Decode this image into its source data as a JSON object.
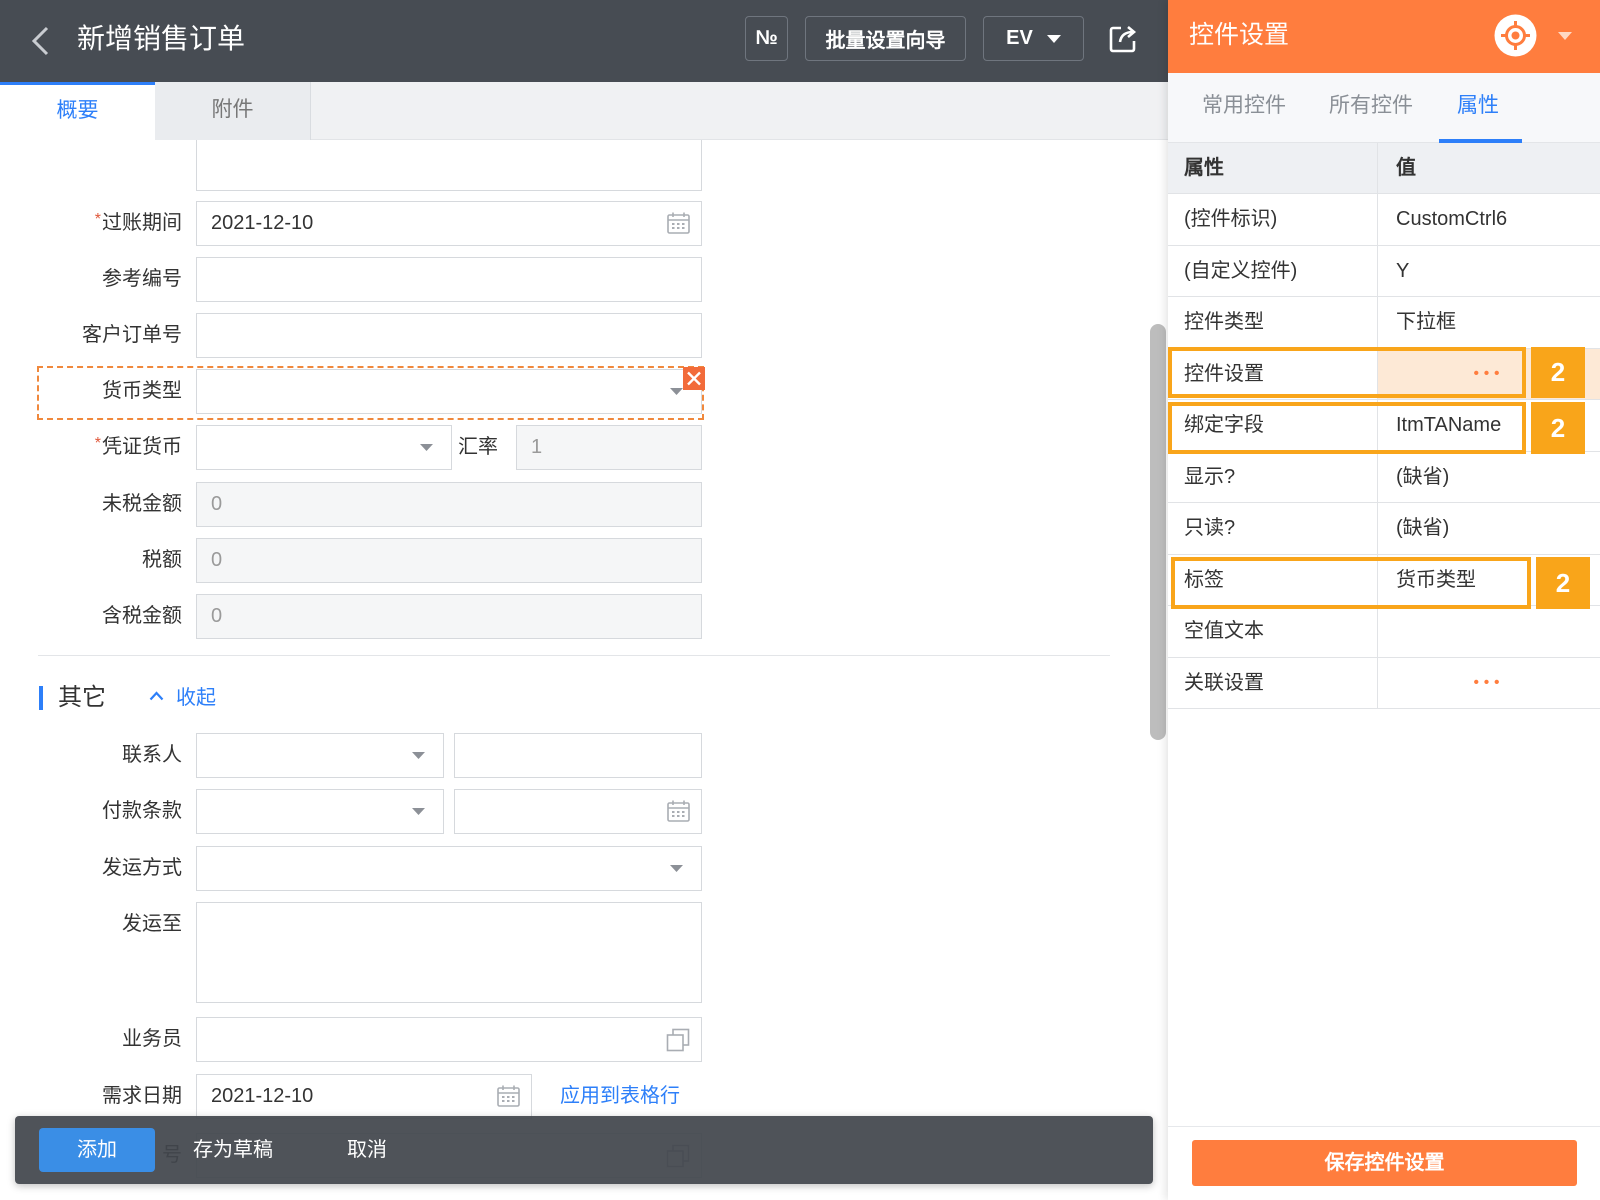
{
  "header": {
    "title": "新增销售订单",
    "number_button": "№",
    "batch_button": "批量设置向导",
    "ev_button": "EV"
  },
  "icons": {
    "back": "chevron-left-icon",
    "share": "share-icon",
    "calendar": "calendar-icon",
    "caret": "caret-down-icon",
    "copy": "copy-icon",
    "close": "close-icon",
    "locate": "crosshair-icon",
    "collapse": "chevron-up-icon"
  },
  "tabs": [
    {
      "label": "概要",
      "active": true
    },
    {
      "label": "附件",
      "active": false
    }
  ],
  "form": {
    "required_mark": "*",
    "posting_period": {
      "label": "过账期间",
      "value": "2021-12-10"
    },
    "reference_no": {
      "label": "参考编号",
      "value": ""
    },
    "customer_order_no": {
      "label": "客户订单号",
      "value": ""
    },
    "currency_type": {
      "label": "货币类型",
      "value": ""
    },
    "voucher_currency": {
      "label": "凭证货币",
      "value": ""
    },
    "exchange_rate": {
      "label": "汇率",
      "value": "1"
    },
    "untaxed_amount": {
      "label": "未税金额",
      "value": "0"
    },
    "tax_amount": {
      "label": "税额",
      "value": "0"
    },
    "taxed_amount": {
      "label": "含税金额",
      "value": "0"
    }
  },
  "other": {
    "title": "其它",
    "collapse_label": "收起",
    "contact": {
      "label": "联系人"
    },
    "payment_terms": {
      "label": "付款条款"
    },
    "shipping_method": {
      "label": "发运方式"
    },
    "ship_to": {
      "label": "发运至"
    },
    "salesperson": {
      "label": "业务员"
    },
    "required_date": {
      "label": "需求日期",
      "value": "2021-12-10",
      "apply_link": "应用到表格行"
    },
    "partial_field": {
      "label": "号"
    }
  },
  "action_bar": {
    "add": "添加",
    "save_draft": "存为草稿",
    "cancel": "取消"
  },
  "panel": {
    "title": "控件设置",
    "tabs": [
      {
        "label": "常用控件",
        "active": false
      },
      {
        "label": "所有控件",
        "active": false
      },
      {
        "label": "属性",
        "active": true
      }
    ],
    "table": {
      "headers": {
        "property": "属性",
        "value": "值"
      },
      "rows": [
        {
          "property": "(控件标识)",
          "value": "CustomCtrl6"
        },
        {
          "property": "(自定义控件)",
          "value": "Y"
        },
        {
          "property": "控件类型",
          "value": "下拉框"
        },
        {
          "property": "控件设置",
          "value": "•••"
        },
        {
          "property": "绑定字段",
          "value": "ItmTAName"
        },
        {
          "property": "显示?",
          "value": "(缺省)"
        },
        {
          "property": "只读?",
          "value": "(缺省)"
        },
        {
          "property": "标签",
          "value": "货币类型"
        },
        {
          "property": "空值文本",
          "value": ""
        },
        {
          "property": "关联设置",
          "value": "•••"
        }
      ],
      "selected_row": 3
    },
    "save_button": "保存控件设置"
  },
  "annotations": [
    {
      "badge": "2"
    },
    {
      "badge": "2"
    },
    {
      "badge": "2"
    }
  ],
  "colors": {
    "header_bg": "#474c53",
    "accent_orange": "#ff7d3e",
    "link_blue": "#2d7ff9",
    "annotation": "#f9a51a",
    "selection": "#fde9d6"
  }
}
